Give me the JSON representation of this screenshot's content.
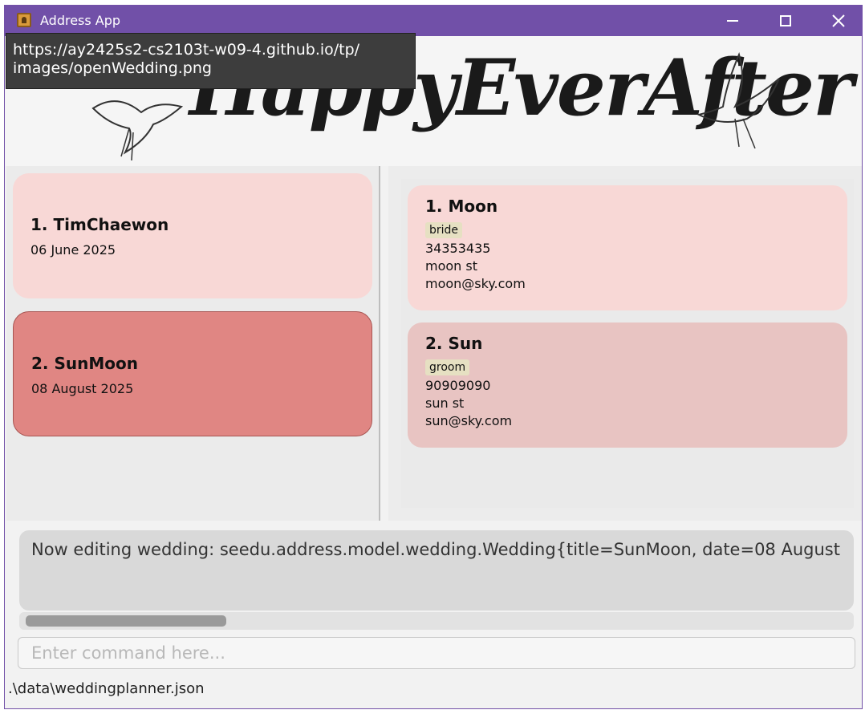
{
  "window": {
    "title": "Address App"
  },
  "tooltip": {
    "line1": "https://ay2425s2-cs2103t-w09-4.github.io/tp/",
    "line2": "images/openWedding.png"
  },
  "banner": {
    "text": "HappyEverAfter"
  },
  "weddings": [
    {
      "title": "1. TimChaewon",
      "date": "06 June 2025",
      "selected": false
    },
    {
      "title": "2. SunMoon",
      "date": "08 August 2025",
      "selected": true
    }
  ],
  "persons": [
    {
      "name": "1. Moon",
      "tag": "bride",
      "phone": "34353435",
      "address": "moon st",
      "email": "moon@sky.com"
    },
    {
      "name": "2. Sun",
      "tag": "groom",
      "phone": "90909090",
      "address": "sun st",
      "email": "sun@sky.com"
    }
  ],
  "result": {
    "text": "Now editing wedding: seedu.address.model.wedding.Wedding{title=SunMoon, date=08 August"
  },
  "command": {
    "placeholder": "Enter command here..."
  },
  "status": {
    "path": ".\\data\\weddingplanner.json"
  },
  "colors": {
    "titlebar": "#7150a8",
    "card": "#f8d8d6",
    "selected_card": "#e08683",
    "tag": "#e6e0c2"
  },
  "icons": [
    "app-icon",
    "minimize-icon",
    "maximize-icon",
    "close-icon",
    "dove-icon"
  ]
}
